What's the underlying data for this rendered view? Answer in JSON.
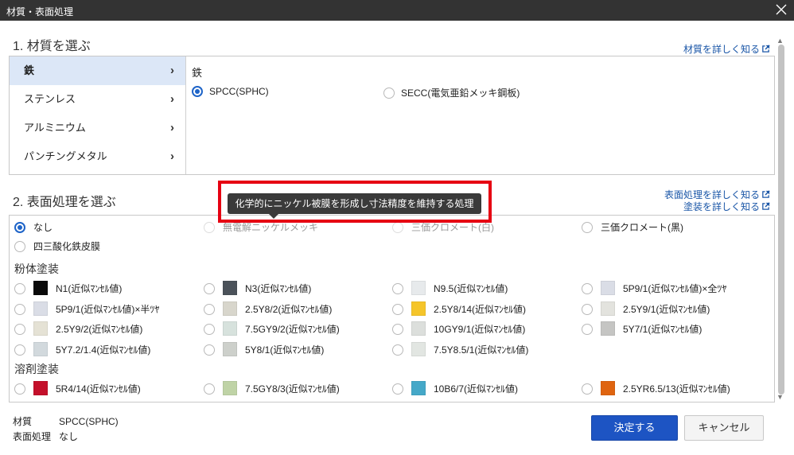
{
  "dialog": {
    "title": "材質・表面処理"
  },
  "material": {
    "section_title": "1. 材質を選ぶ",
    "help_link": "材質を詳しく知る",
    "categories": [
      {
        "label": "鉄"
      },
      {
        "label": "ステンレス"
      },
      {
        "label": "アルミニウム"
      },
      {
        "label": "パンチングメタル"
      }
    ],
    "selected_group": "鉄",
    "options": [
      {
        "label": "SPCC(SPHC)"
      },
      {
        "label": "SECC(電気亜鉛メッキ鋼板)"
      }
    ]
  },
  "surface": {
    "section_title": "2. 表面処理を選ぶ",
    "help_link_1": "表面処理を詳しく知る",
    "help_link_2": "塗装を詳しく知る",
    "basic": [
      {
        "label": "なし"
      },
      {
        "label": "無電解ニッケルメッキ"
      },
      {
        "label": "三価クロメート(白)"
      },
      {
        "label": "三価クロメート(黒)"
      },
      {
        "label": "四三酸化鉄皮膜"
      }
    ],
    "powder_title": "粉体塗装",
    "powder": [
      {
        "label": "N1(近似ﾏﾝｾﾙ値)",
        "color": "#0a0a0a"
      },
      {
        "label": "N3(近似ﾏﾝｾﾙ値)",
        "color": "#4b525a"
      },
      {
        "label": "N9.5(近似ﾏﾝｾﾙ値)",
        "color": "#e7eaec"
      },
      {
        "label": "5P9/1(近似ﾏﾝｾﾙ値)×全ﾂﾔ",
        "color": "#dadde6"
      },
      {
        "label": "5P9/1(近似ﾏﾝｾﾙ値)×半ﾂﾔ",
        "color": "#dadde6"
      },
      {
        "label": "2.5Y8/2(近似ﾏﾝｾﾙ値)",
        "color": "#d8d6cc"
      },
      {
        "label": "2.5Y8/14(近似ﾏﾝｾﾙ値)",
        "color": "#f5c52a"
      },
      {
        "label": "2.5Y9/1(近似ﾏﾝｾﾙ値)",
        "color": "#e3e3de"
      },
      {
        "label": "2.5Y9/2(近似ﾏﾝｾﾙ値)",
        "color": "#e5e2d5"
      },
      {
        "label": "7.5GY9/2(近似ﾏﾝｾﾙ値)",
        "color": "#d7e2dd"
      },
      {
        "label": "10GY9/1(近似ﾏﾝｾﾙ値)",
        "color": "#dcdfdc"
      },
      {
        "label": "5Y7/1(近似ﾏﾝｾﾙ値)",
        "color": "#c5c5c3"
      },
      {
        "label": "5Y7.2/1.4(近似ﾏﾝｾﾙ値)",
        "color": "#d2d9dd"
      },
      {
        "label": "5Y8/1(近似ﾏﾝｾﾙ値)",
        "color": "#cdd0cb"
      },
      {
        "label": "7.5Y8.5/1(近似ﾏﾝｾﾙ値)",
        "color": "#e2e6e2"
      }
    ],
    "solvent_title": "溶剤塗装",
    "solvent": [
      {
        "label": "5R4/14(近似ﾏﾝｾﾙ値)",
        "color": "#c4102b"
      },
      {
        "label": "7.5GY8/3(近似ﾏﾝｾﾙ値)",
        "color": "#bfd3a6"
      },
      {
        "label": "10B6/7(近似ﾏﾝｾﾙ値)",
        "color": "#45a8c8"
      },
      {
        "label": "2.5YR6.5/13(近似ﾏﾝｾﾙ値)",
        "color": "#df6410"
      }
    ]
  },
  "tooltip": {
    "text": "化学的にニッケル被膜を形成し寸法精度を維持する処理"
  },
  "summary": {
    "material_key": "材質",
    "material_value": "SPCC(SPHC)",
    "surface_key": "表面処理",
    "surface_value": "なし"
  },
  "buttons": {
    "confirm": "決定する",
    "cancel": "キャンセル"
  },
  "colors": {
    "accent": "#1e64c8",
    "primary_button": "#1d54c3",
    "highlight": "#e60012"
  }
}
